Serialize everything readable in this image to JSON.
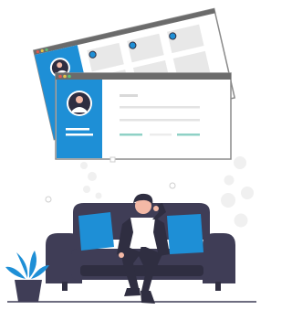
{
  "colors": {
    "accent": "#1e8fd6",
    "accent_dark": "#1977b8",
    "window_titlebar": "#6b6b6b",
    "window_border": "#8a8a8a",
    "content_block": "#e8e8e8",
    "line_gray": "#d9d9d9",
    "line_teal": "#8fd1c6",
    "dot_red": "#e05a4f",
    "dot_yellow": "#e7c24a",
    "dot_green": "#5ebf73",
    "couch": "#3f3d56",
    "couch_dark": "#2f2e41",
    "cushion": "#1e8fd6",
    "skin": "#f3b9a6",
    "hair": "#2f2e41",
    "shirt": "#ffffff",
    "pants": "#2f2e41",
    "plant_leaf": "#1e8fd6",
    "pot": "#3f3d56",
    "floor": "#3f3d56",
    "bubble": "#f0f0f0"
  },
  "icons": {
    "back_window_avatar": "user-avatar-icon",
    "front_window_avatar": "user-avatar-icon"
  }
}
